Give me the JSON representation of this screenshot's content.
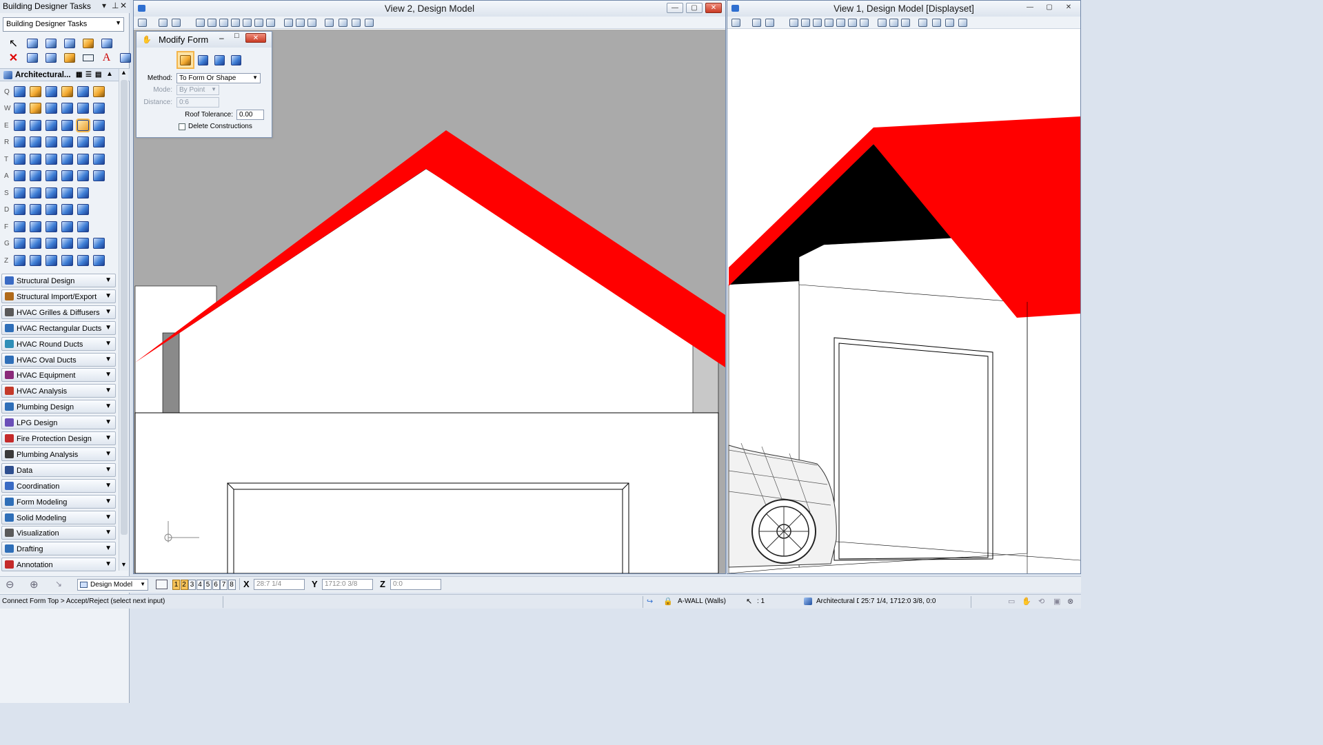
{
  "left_panel": {
    "title": "Building Designer Tasks",
    "combo_value": "Building Designer Tasks",
    "section_title": "Architectural...",
    "row_letters": [
      "Q",
      "W",
      "E",
      "R",
      "T",
      "A",
      "S",
      "D",
      "F",
      "G",
      "Z"
    ],
    "groups": [
      {
        "label": "Structural Design",
        "color": "#3a6bc4"
      },
      {
        "label": "Structural Import/Export",
        "color": "#b06a1a"
      },
      {
        "label": "HVAC Grilles & Diffusers",
        "color": "#5a5a5a"
      },
      {
        "label": "HVAC Rectangular Ducts",
        "color": "#2f6fb8"
      },
      {
        "label": "HVAC Round Ducts",
        "color": "#2f8fb8"
      },
      {
        "label": "HVAC Oval Ducts",
        "color": "#2f6fb8"
      },
      {
        "label": "HVAC Equipment",
        "color": "#8a2a7a"
      },
      {
        "label": "HVAC Analysis",
        "color": "#c43a2a"
      },
      {
        "label": "Plumbing Design",
        "color": "#2f6fb8"
      },
      {
        "label": "LPG Design",
        "color": "#6a4fb8"
      },
      {
        "label": "Fire Protection Design",
        "color": "#c42a2a"
      },
      {
        "label": "Plumbing Analysis",
        "color": "#3a3a3a"
      },
      {
        "label": "Data",
        "color": "#2f4f8f"
      },
      {
        "label": "Coordination",
        "color": "#3a6bc4"
      },
      {
        "label": "Form Modeling",
        "color": "#2f6fb8"
      },
      {
        "label": "Solid Modeling",
        "color": "#2f6fb8"
      },
      {
        "label": "Visualization",
        "color": "#5a5a5a"
      },
      {
        "label": "Drafting",
        "color": "#2f6fb8"
      },
      {
        "label": "Annotation",
        "color": "#c42a2a"
      }
    ]
  },
  "view2": {
    "title": "View 2, Design Model"
  },
  "view1": {
    "title": "View 1, Design Model [Displayset]"
  },
  "modify_form": {
    "title": "Modify Form",
    "method_label": "Method:",
    "method_value": "To Form Or Shape",
    "mode_label": "Mode:",
    "mode_value": "By Point",
    "distance_label": "Distance:",
    "distance_value": "0:6",
    "roof_tolerance_label": "Roof Tolerance:",
    "roof_tolerance_value": "0.00",
    "delete_constructions_label": "Delete Constructions"
  },
  "bottom_toolbar": {
    "model_value": "Design Model",
    "view_buttons": [
      "1",
      "2",
      "3",
      "4",
      "5",
      "6",
      "7",
      "8"
    ],
    "x_label": "X",
    "x_value": "28:7 1/4",
    "y_label": "Y",
    "y_value": "1712:0 3/8",
    "z_label": "Z",
    "z_value": "0:0"
  },
  "status_bar": {
    "prompt": "Connect Form Top > Accept/Reject (select next input)",
    "level": "A-WALL (Walls)",
    "scale": ": 1",
    "family": "Architectural De",
    "coords": "25:7 1/4, 1712:0 3/8, 0:0"
  },
  "colors": {
    "roof": "#ff0000",
    "gable_shadow": "#000000",
    "ground_gray": "#aaaaaa"
  }
}
